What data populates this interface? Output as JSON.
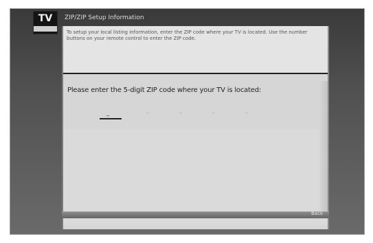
{
  "logo": {
    "text": "TV"
  },
  "header": {
    "title": "ZIP/ZIP Setup Information"
  },
  "info": {
    "text": "To setup your local listing information, enter the ZIP code where your TV is located. Use the number buttons on your remote control to enter the ZIP code."
  },
  "prompt": "Please enter the 5-digit ZIP code where your TV is located:",
  "zip_digits": [
    "_",
    "-",
    "-",
    "-",
    "-"
  ],
  "footer": {
    "hint": "Back"
  },
  "colors": {
    "frame": "#505050",
    "panel": "#d6d6d6",
    "info_box": "#e4e4e4",
    "text": "#222222"
  }
}
